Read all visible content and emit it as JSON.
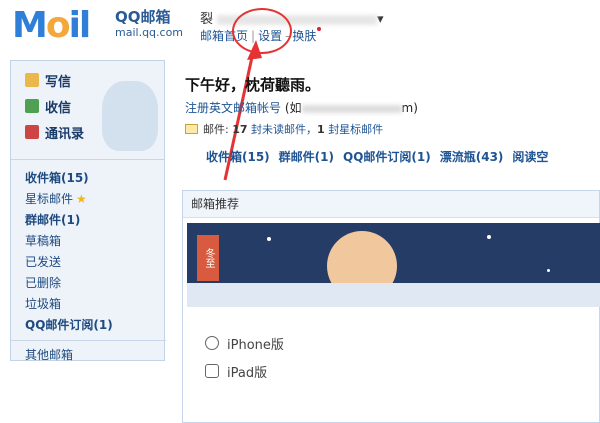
{
  "header": {
    "logo_brand": "QQ邮箱",
    "logo_url": "mail.qq.com",
    "account_name_prefix": "裂",
    "account_caret": "▾",
    "links": {
      "home": "邮箱首页",
      "separator": "|",
      "settings": "设置",
      "dash": "-",
      "skin": "换肤"
    }
  },
  "sidebar": {
    "commands": [
      {
        "label": "写信",
        "icon": "compose-icon"
      },
      {
        "label": "收信",
        "icon": "inbox-download-icon"
      },
      {
        "label": "通讯录",
        "icon": "contacts-icon"
      }
    ],
    "folders": [
      {
        "label": "收件箱(15)",
        "bold": true
      },
      {
        "label": "星标邮件",
        "star": "★"
      },
      {
        "label": "群邮件(1)",
        "bold": true
      },
      {
        "label": "草稿箱"
      },
      {
        "label": "已发送"
      },
      {
        "label": "已删除"
      },
      {
        "label": "垃圾箱"
      },
      {
        "label": "QQ邮件订阅(1)",
        "bold": true
      }
    ],
    "other": "其他邮箱"
  },
  "main": {
    "greeting": "下午好，枕荷聽雨。",
    "register_prefix": "注册英文邮箱帐号",
    "register_paren": "(如",
    "register_suffix": "m)",
    "mail_label": "邮件:",
    "unread_count": "17",
    "unread_text": "封未读邮件，",
    "starred_count": "1",
    "starred_text": "封星标邮件",
    "quick_links": [
      "收件箱(15)",
      "群邮件(1)",
      "QQ邮件订阅(1)",
      "漂流瓶(43)",
      "阅读空"
    ],
    "panel_title": "邮箱推荐",
    "banner_tag": "冬至",
    "apps": [
      "iPhone版",
      "iPad版"
    ]
  }
}
